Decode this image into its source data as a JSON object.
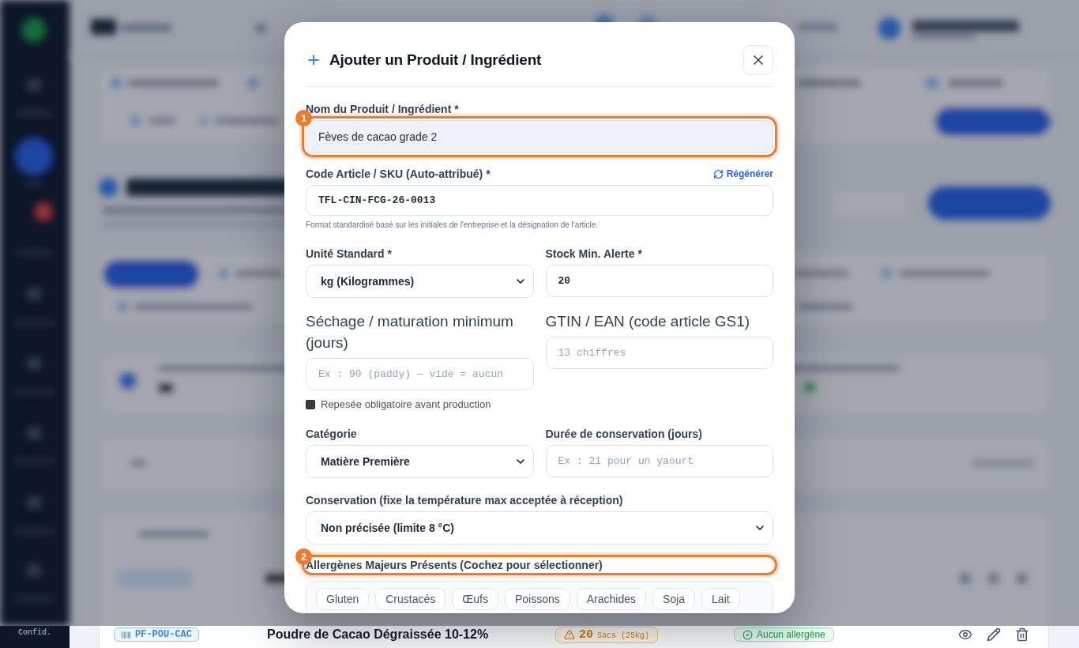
{
  "dialog": {
    "title": "Ajouter un Produit / Ingrédient",
    "name_field": {
      "label": "Nom du Produit / Ingrédient *",
      "value": "Fèves de cacao grade 2",
      "marker": "1"
    },
    "sku_field": {
      "label": "Code Article / SKU (Auto-attribué) *",
      "action": "Régénérer",
      "value": "TFL-CIN-FCG-26-0013",
      "hint": "Format standardisé basé sur les initiales de l'entreprise et la désignation de l'article."
    },
    "grid_fields": [
      {
        "kind": "select",
        "label": "Unité Standard *",
        "large_label": false,
        "value": "kg (Kilogrammes)"
      },
      {
        "kind": "input",
        "label": "Stock Min. Alerte *",
        "large_label": false,
        "value": "20"
      },
      {
        "kind": "input",
        "label": "Séchage / maturation minimum (jours)",
        "large_label": true,
        "placeholder": "Ex : 90 (paddy) — vide = aucun",
        "checkbox": {
          "label": "Repesée obligatoire avant production",
          "checked": false
        }
      },
      {
        "kind": "input",
        "label": "GTIN / EAN (code article GS1)",
        "large_label": true,
        "placeholder": "13 chiffres"
      },
      {
        "kind": "select",
        "label": "Catégorie",
        "large_label": false,
        "value": "Matière Première"
      },
      {
        "kind": "input",
        "label": "Durée de conservation (jours)",
        "large_label": false,
        "placeholder": "Ex : 21 pour un yaourt"
      }
    ],
    "conservation_field": {
      "label": "Conservation (fixe la température max acceptée à réception)",
      "value": "Non précisée (limite 8 °C)"
    },
    "allergens": {
      "label": "Allergènes Majeurs Présents (Cochez pour sélectionner)",
      "marker": "2",
      "items": [
        {
          "label": "Gluten",
          "checked": false
        },
        {
          "label": "Crustacés",
          "checked": false
        },
        {
          "label": "Œufs",
          "checked": false
        },
        {
          "label": "Poissons",
          "checked": false
        },
        {
          "label": "Arachides",
          "checked": false
        },
        {
          "label": "Soja",
          "checked": false
        },
        {
          "label": "Lait",
          "checked": false
        }
      ]
    }
  },
  "sidebar": {
    "footer": "Confid."
  },
  "product_row": {
    "code": "PF-POU-CAC",
    "name": "Poudre de Cacao Dégraissée 10-12%",
    "stock": {
      "quantity": "20",
      "unit": "Sacs (25kg)",
      "low": true
    },
    "allergens": "Aucun allergène"
  }
}
